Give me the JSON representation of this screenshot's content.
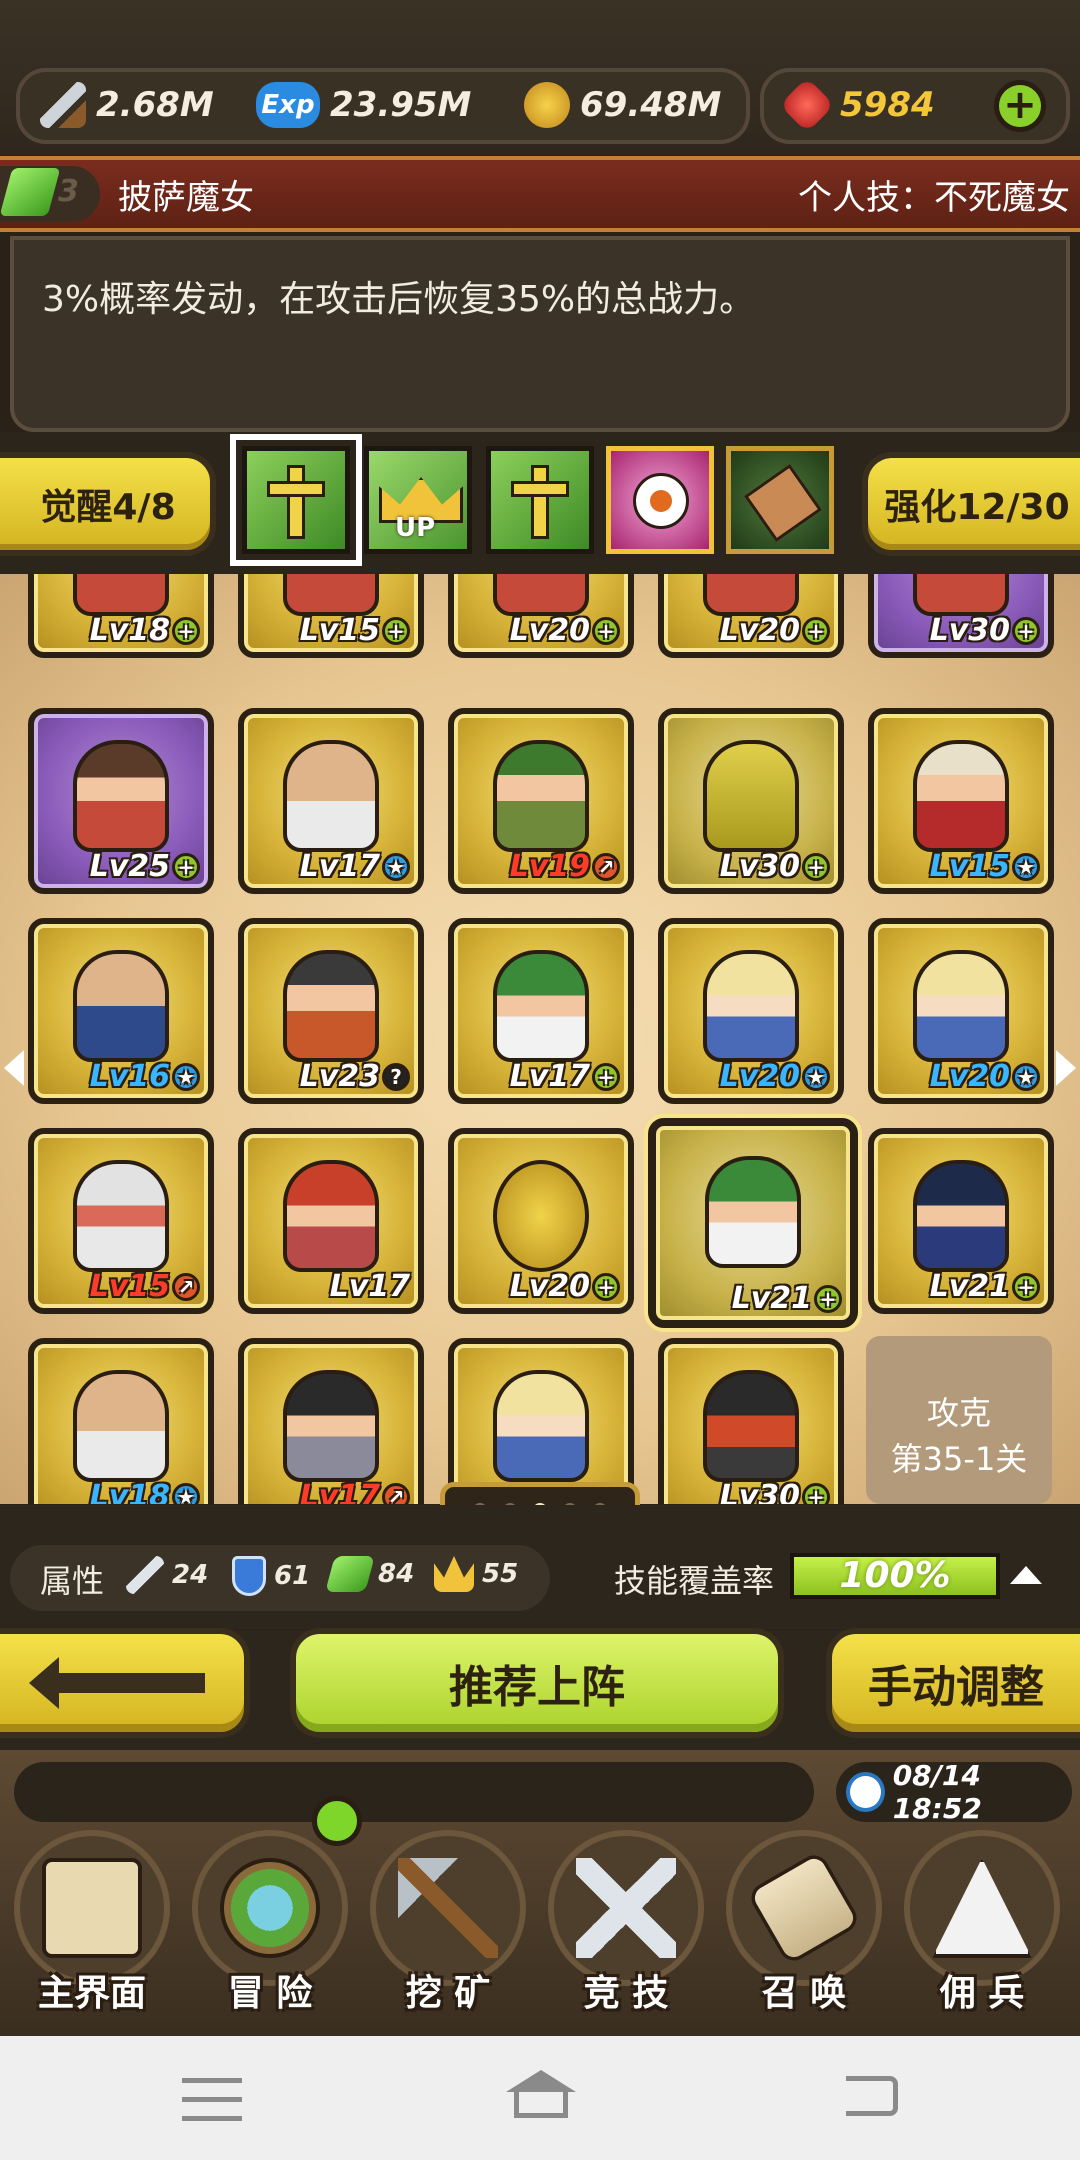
{
  "resources": {
    "attack": "2.68M",
    "exp": "23.95M",
    "gold": "69.48M",
    "ruby": "5984"
  },
  "hero": {
    "gem_count": "3",
    "name": "披萨魔女",
    "skill_label": "个人技：不死魔女",
    "description": "3%概率发动，在攻击后恢复35%的总战力。"
  },
  "awaken_label": "觉醒4/8",
  "enhance_label": "强化12/30",
  "grid": {
    "row0": [
      "Lv18",
      "Lv15",
      "Lv20",
      "Lv20",
      "Lv30"
    ],
    "row1": [
      "Lv25",
      "Lv17",
      "Lv19",
      "Lv30",
      "Lv15"
    ],
    "row2": [
      "Lv16",
      "Lv23",
      "Lv17",
      "Lv20",
      "Lv20"
    ],
    "row3": [
      "Lv15",
      "Lv17",
      "Lv20",
      "Lv21",
      "Lv21"
    ],
    "row4": [
      "Lv18",
      "Lv17",
      "",
      "Lv30"
    ]
  },
  "stage": {
    "line1": "攻克",
    "line2": "第35-1关"
  },
  "attributes": {
    "label": "属性",
    "sword": "24",
    "shield": "61",
    "gem": "84",
    "crown": "55",
    "coverage_label": "技能覆盖率",
    "coverage_value": "100%",
    "coverage_fraction": 1.0
  },
  "actions": {
    "recommend": "推荐上阵",
    "manual": "手动调整"
  },
  "time": "08/14 18:52",
  "nav": [
    "主界面",
    "冒 险",
    "挖 矿",
    "竞 技",
    "召 唤",
    "佣 兵"
  ]
}
